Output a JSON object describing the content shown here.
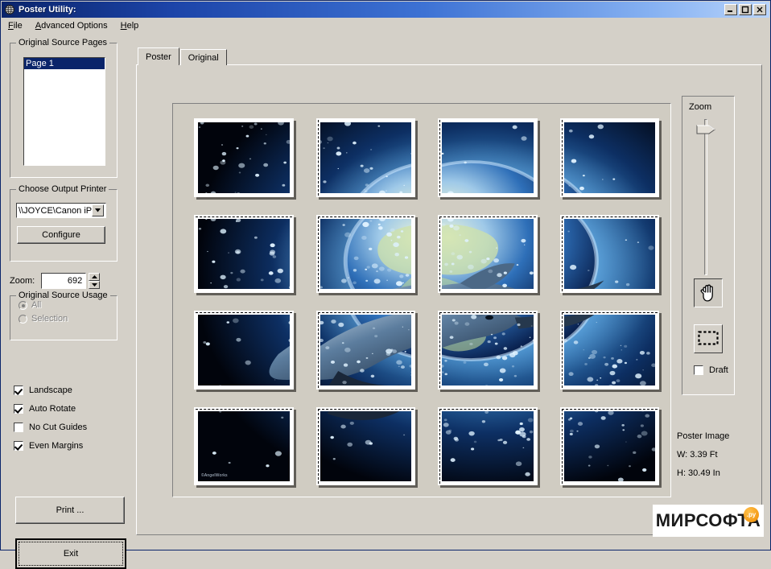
{
  "window": {
    "title": "Poster Utility:",
    "icon": "app-globe-icon",
    "minimize_label": "_",
    "maximize_label": "□",
    "close_label": "✕"
  },
  "menubar": {
    "items": [
      {
        "label": "File",
        "accel": "F"
      },
      {
        "label": "Advanced Options",
        "accel": "A"
      },
      {
        "label": "Help",
        "accel": "H"
      }
    ]
  },
  "source_pages": {
    "group_title": "Original Source Pages",
    "items": [
      {
        "label": "Page 1",
        "selected": true
      }
    ]
  },
  "printer": {
    "group_title": "Choose Output Printer",
    "selected": "\\\\JOYCE\\Canon iP",
    "options": [
      "\\\\JOYCE\\Canon iP"
    ],
    "configure_label": "Configure"
  },
  "zoom_field": {
    "label": "Zoom:",
    "value": "692"
  },
  "source_usage": {
    "group_title": "Original Source Usage",
    "options": [
      {
        "label": "All",
        "selected": true,
        "disabled": true
      },
      {
        "label": "Selection",
        "selected": false,
        "disabled": true
      }
    ]
  },
  "options": [
    {
      "label": "Landscape",
      "checked": true
    },
    {
      "label": "Auto Rotate",
      "checked": true
    },
    {
      "label": "No Cut Guides",
      "checked": false
    },
    {
      "label": "Even Margins",
      "checked": true
    }
  ],
  "actions": {
    "print_label": "Print ...",
    "exit_label": "Exit"
  },
  "tabs": [
    {
      "label": "Poster",
      "active": true
    },
    {
      "label": "Original",
      "active": false
    }
  ],
  "zoom_panel": {
    "label": "Zoom",
    "slider_value": 96,
    "hand_tool": "hand-tool",
    "marquee_tool": "marquee-select-tool",
    "draft": {
      "label": "Draft",
      "checked": false
    }
  },
  "poster_info": {
    "heading": "Poster Image",
    "width": "W: 3.39 Ft",
    "height": "H: 30.49 In"
  },
  "poster": {
    "columns": 4,
    "rows": 4,
    "tile_count": 16,
    "image_caption": "©AngelWorks"
  },
  "watermark": {
    "text": "МИРСОФТА",
    "badge": ".ру",
    "badge_color": "#f08a00"
  },
  "colors": {
    "face": "#d4d0c8",
    "title_start": "#0a246a",
    "title_end": "#b9d4fb",
    "selection": "#0a246a",
    "canvas": "#d0ccc2"
  }
}
